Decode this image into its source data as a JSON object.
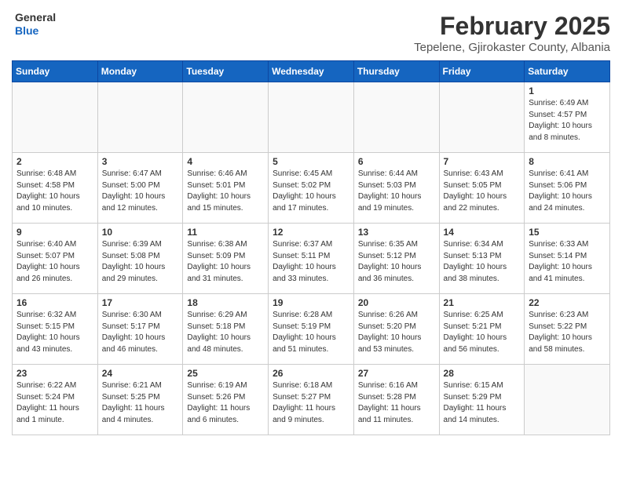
{
  "header": {
    "logo_general": "General",
    "logo_blue": "Blue",
    "month_title": "February 2025",
    "location": "Tepelene, Gjirokaster County, Albania"
  },
  "weekdays": [
    "Sunday",
    "Monday",
    "Tuesday",
    "Wednesday",
    "Thursday",
    "Friday",
    "Saturday"
  ],
  "weeks": [
    [
      {
        "day": "",
        "info": ""
      },
      {
        "day": "",
        "info": ""
      },
      {
        "day": "",
        "info": ""
      },
      {
        "day": "",
        "info": ""
      },
      {
        "day": "",
        "info": ""
      },
      {
        "day": "",
        "info": ""
      },
      {
        "day": "1",
        "info": "Sunrise: 6:49 AM\nSunset: 4:57 PM\nDaylight: 10 hours and 8 minutes."
      }
    ],
    [
      {
        "day": "2",
        "info": "Sunrise: 6:48 AM\nSunset: 4:58 PM\nDaylight: 10 hours and 10 minutes."
      },
      {
        "day": "3",
        "info": "Sunrise: 6:47 AM\nSunset: 5:00 PM\nDaylight: 10 hours and 12 minutes."
      },
      {
        "day": "4",
        "info": "Sunrise: 6:46 AM\nSunset: 5:01 PM\nDaylight: 10 hours and 15 minutes."
      },
      {
        "day": "5",
        "info": "Sunrise: 6:45 AM\nSunset: 5:02 PM\nDaylight: 10 hours and 17 minutes."
      },
      {
        "day": "6",
        "info": "Sunrise: 6:44 AM\nSunset: 5:03 PM\nDaylight: 10 hours and 19 minutes."
      },
      {
        "day": "7",
        "info": "Sunrise: 6:43 AM\nSunset: 5:05 PM\nDaylight: 10 hours and 22 minutes."
      },
      {
        "day": "8",
        "info": "Sunrise: 6:41 AM\nSunset: 5:06 PM\nDaylight: 10 hours and 24 minutes."
      }
    ],
    [
      {
        "day": "9",
        "info": "Sunrise: 6:40 AM\nSunset: 5:07 PM\nDaylight: 10 hours and 26 minutes."
      },
      {
        "day": "10",
        "info": "Sunrise: 6:39 AM\nSunset: 5:08 PM\nDaylight: 10 hours and 29 minutes."
      },
      {
        "day": "11",
        "info": "Sunrise: 6:38 AM\nSunset: 5:09 PM\nDaylight: 10 hours and 31 minutes."
      },
      {
        "day": "12",
        "info": "Sunrise: 6:37 AM\nSunset: 5:11 PM\nDaylight: 10 hours and 33 minutes."
      },
      {
        "day": "13",
        "info": "Sunrise: 6:35 AM\nSunset: 5:12 PM\nDaylight: 10 hours and 36 minutes."
      },
      {
        "day": "14",
        "info": "Sunrise: 6:34 AM\nSunset: 5:13 PM\nDaylight: 10 hours and 38 minutes."
      },
      {
        "day": "15",
        "info": "Sunrise: 6:33 AM\nSunset: 5:14 PM\nDaylight: 10 hours and 41 minutes."
      }
    ],
    [
      {
        "day": "16",
        "info": "Sunrise: 6:32 AM\nSunset: 5:15 PM\nDaylight: 10 hours and 43 minutes."
      },
      {
        "day": "17",
        "info": "Sunrise: 6:30 AM\nSunset: 5:17 PM\nDaylight: 10 hours and 46 minutes."
      },
      {
        "day": "18",
        "info": "Sunrise: 6:29 AM\nSunset: 5:18 PM\nDaylight: 10 hours and 48 minutes."
      },
      {
        "day": "19",
        "info": "Sunrise: 6:28 AM\nSunset: 5:19 PM\nDaylight: 10 hours and 51 minutes."
      },
      {
        "day": "20",
        "info": "Sunrise: 6:26 AM\nSunset: 5:20 PM\nDaylight: 10 hours and 53 minutes."
      },
      {
        "day": "21",
        "info": "Sunrise: 6:25 AM\nSunset: 5:21 PM\nDaylight: 10 hours and 56 minutes."
      },
      {
        "day": "22",
        "info": "Sunrise: 6:23 AM\nSunset: 5:22 PM\nDaylight: 10 hours and 58 minutes."
      }
    ],
    [
      {
        "day": "23",
        "info": "Sunrise: 6:22 AM\nSunset: 5:24 PM\nDaylight: 11 hours and 1 minute."
      },
      {
        "day": "24",
        "info": "Sunrise: 6:21 AM\nSunset: 5:25 PM\nDaylight: 11 hours and 4 minutes."
      },
      {
        "day": "25",
        "info": "Sunrise: 6:19 AM\nSunset: 5:26 PM\nDaylight: 11 hours and 6 minutes."
      },
      {
        "day": "26",
        "info": "Sunrise: 6:18 AM\nSunset: 5:27 PM\nDaylight: 11 hours and 9 minutes."
      },
      {
        "day": "27",
        "info": "Sunrise: 6:16 AM\nSunset: 5:28 PM\nDaylight: 11 hours and 11 minutes."
      },
      {
        "day": "28",
        "info": "Sunrise: 6:15 AM\nSunset: 5:29 PM\nDaylight: 11 hours and 14 minutes."
      },
      {
        "day": "",
        "info": ""
      }
    ]
  ]
}
